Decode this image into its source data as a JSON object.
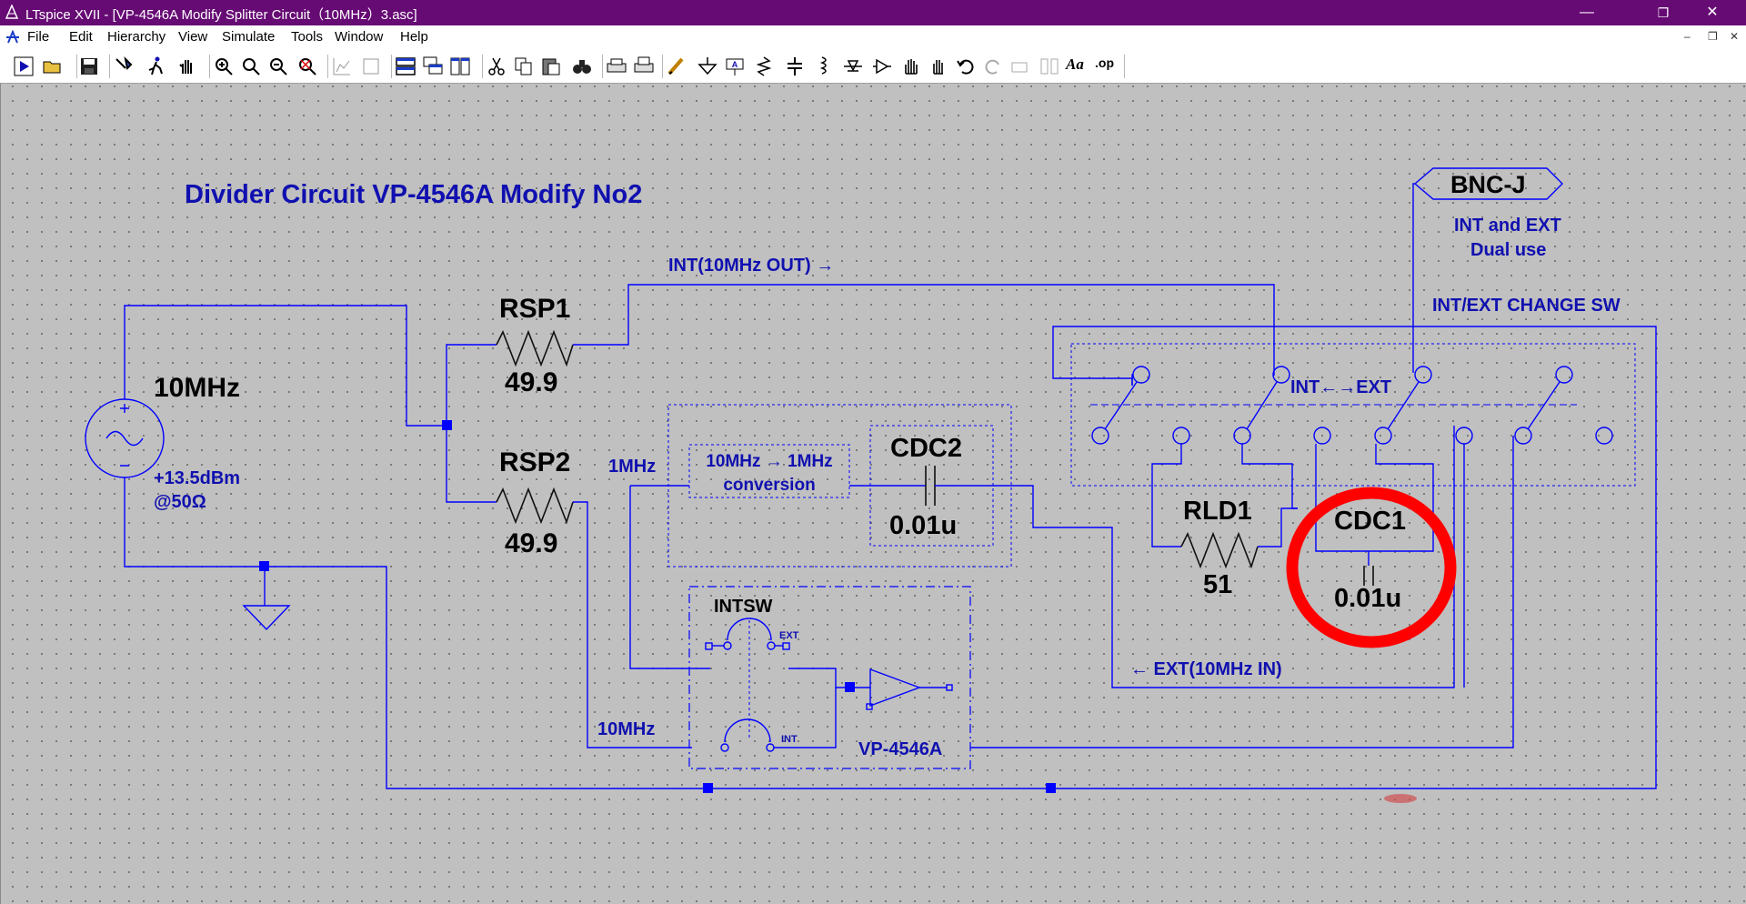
{
  "window": {
    "title": "LTspice XVII - [VP-4546A Modify Splitter Circuit（10MHz）3.asc]",
    "controls": [
      "—",
      "❐",
      "✕"
    ]
  },
  "menu": [
    {
      "label": "File"
    },
    {
      "label": "Edit"
    },
    {
      "label": "Hierarchy"
    },
    {
      "label": "View"
    },
    {
      "label": "Simulate"
    },
    {
      "label": "Tools"
    },
    {
      "label": "Window"
    },
    {
      "label": "Help"
    }
  ],
  "toolbar": {
    "icons": [
      "run-icon",
      "open-icon",
      "save-icon",
      "control-panel-icon",
      "halt-icon",
      "pan-icon",
      "zoom-in-icon",
      "zoom-area-icon",
      "zoom-out-icon",
      "zoom-cancel-icon",
      "autorange-icon",
      "fit-icon",
      "tile-horizontal-icon",
      "cascade-icon",
      "tile-vertical-icon",
      "cut-icon",
      "copy-icon",
      "paste-icon",
      "find-icon",
      "print-setup-icon",
      "print-icon",
      "wire-icon",
      "ground-icon",
      "label-net-icon",
      "resistor-icon",
      "capacitor-icon",
      "inductor-icon",
      "diode-icon",
      "component-icon",
      "move-icon",
      "drag-icon",
      "undo-icon",
      "redo-icon",
      "rotate-icon",
      "mirror-icon",
      "text-icon",
      "spice-directive-icon"
    ],
    "text_icon": "Aa",
    "directive_icon": ".op"
  },
  "schematic": {
    "title": "Divider Circuit VP-4546A Modify No2",
    "source": {
      "name": "10MHz",
      "level": "+13.5dBm",
      "impedance": "@50Ω"
    },
    "rsp1": {
      "name": "RSP1",
      "value": "49.9"
    },
    "rsp2": {
      "name": "RSP2",
      "value": "49.9"
    },
    "int_out": "INT(10MHz OUT) →",
    "one_mhz": "1MHz",
    "ten_mhz": "10MHz",
    "conversion": {
      "line1": "10MHz → 1MHz",
      "line2": "conversion"
    },
    "cdc2": {
      "name": "CDC2",
      "value": "0.01u"
    },
    "intsw": {
      "name": "INTSW",
      "ext": "EXT",
      "int": "INT"
    },
    "vp": "VP-4546A",
    "bnc": {
      "name": "BNC-J",
      "desc1": "INT and EXT",
      "desc2": "Dual use"
    },
    "change_sw": "INT/EXT CHANGE SW",
    "int_ext": "INT←→EXT",
    "rld1": {
      "name": "RLD1",
      "value": "51"
    },
    "cdc1": {
      "name": "CDC1",
      "value": "0.01u"
    },
    "ext_in": "← EXT(10MHz IN)",
    "colors": {
      "wire": "#0000ff",
      "text_blue": "#1010b0",
      "highlight": "#ff0000",
      "canvas": "#c0c0c0",
      "titlebar": "#660a74"
    }
  }
}
